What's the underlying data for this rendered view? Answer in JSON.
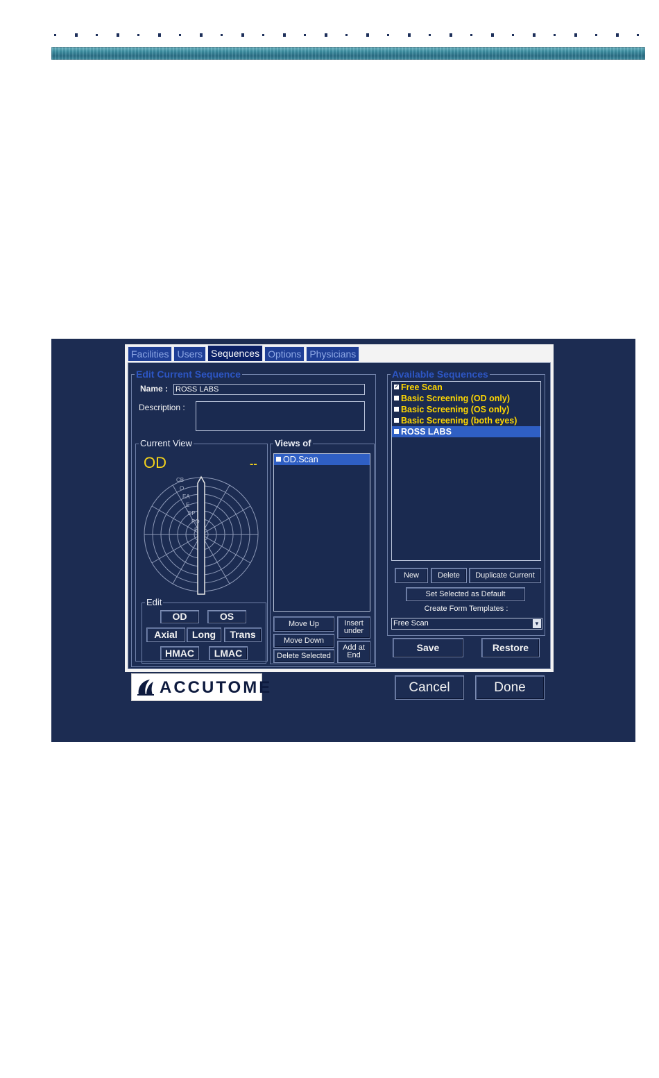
{
  "tabs": [
    "Facilities",
    "Users",
    "Sequences",
    "Options",
    "Physicians"
  ],
  "active_tab": "Sequences",
  "edit_sequence": {
    "title": "Edit Current Sequence",
    "name_label": "Name :",
    "name_value": "ROSS LABS",
    "description_label": "Description :",
    "description_value": ""
  },
  "current_view": {
    "title": "Current View",
    "eye": "OD",
    "indicator": "--",
    "probe_labels": [
      "CB",
      "O",
      "EA",
      "E",
      "EP",
      "PO",
      "P"
    ]
  },
  "edit_group": {
    "title": "Edit",
    "od": "OD",
    "os": "OS",
    "axial": "Axial",
    "long": "Long",
    "trans": "Trans",
    "hmac": "HMAC",
    "lmac": "LMAC"
  },
  "views": {
    "title": "Views of",
    "items": [
      "OD.Scan"
    ],
    "move_up": "Move Up",
    "move_down": "Move Down",
    "delete_selected": "Delete Selected",
    "insert_under_1": "Insert",
    "insert_under_2": "under",
    "add_at_end_1": "Add at",
    "add_at_end_2": "End"
  },
  "available": {
    "title": "Available Sequences",
    "items": [
      "Free Scan",
      "Basic Screening (OD only)",
      "Basic Screening (OS only)",
      "Basic Screening (both eyes)",
      "ROSS LABS"
    ],
    "selected_index": 4,
    "new": "New",
    "delete": "Delete",
    "duplicate": "Duplicate Current",
    "set_default": "Set Selected as Default",
    "create_templates": "Create Form Templates :",
    "template_value": "Free Scan",
    "save": "Save",
    "restore": "Restore"
  },
  "footer": {
    "logo": "ACCUTOME",
    "cancel": "Cancel",
    "done": "Done"
  },
  "colors": {
    "background": "#1c2c52",
    "accent_yellow": "#ffd700",
    "selection_blue": "#2f5fc4",
    "group_title_blue": "#2d56c4"
  }
}
